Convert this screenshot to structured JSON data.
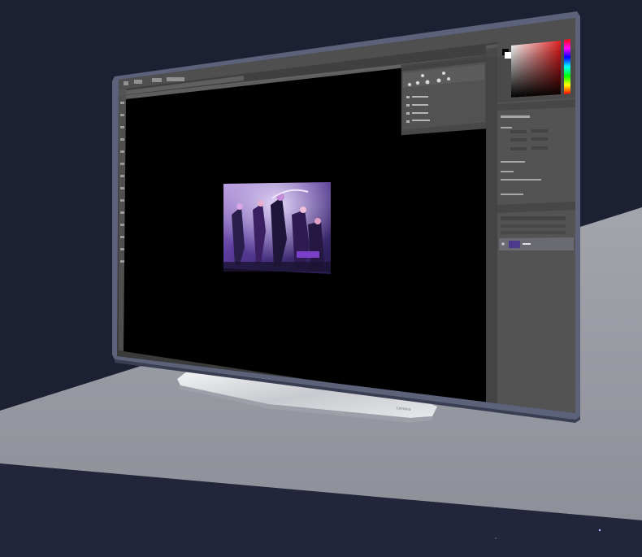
{
  "scene": {
    "stand_brand": "Lenovo",
    "colors": {
      "background": "#1e2135",
      "floor": "#9a9ca4",
      "bezel": "#5a6078",
      "ps_panel": "#535353",
      "canvas": "#000000",
      "hue_red": "#e02020"
    }
  },
  "photoshop": {
    "panels": {
      "brush_presets_items": [
        "",
        "",
        "",
        ""
      ],
      "properties_rows": [
        "",
        "",
        ""
      ],
      "layers_rows": [
        ""
      ]
    }
  }
}
